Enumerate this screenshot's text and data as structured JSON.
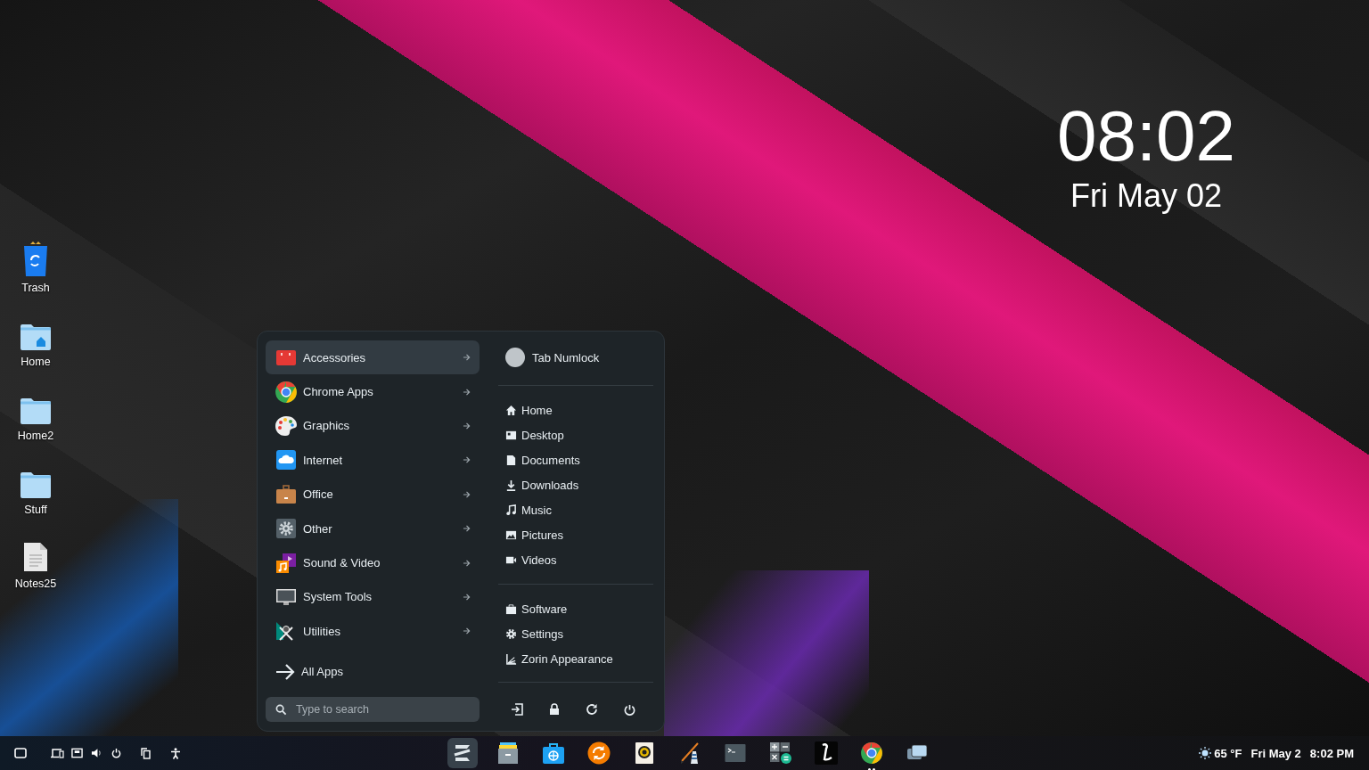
{
  "desktop_icons": [
    {
      "label": "Trash",
      "kind": "trash"
    },
    {
      "label": "Home",
      "kind": "home-folder"
    },
    {
      "label": "Home2",
      "kind": "folder"
    },
    {
      "label": "Stuff",
      "kind": "folder"
    },
    {
      "label": "Notes25",
      "kind": "text-file"
    }
  ],
  "clock": {
    "time": "08:02",
    "date": "Fri May 02"
  },
  "menu": {
    "categories": [
      {
        "label": "Accessories",
        "kind": "accessories",
        "selected": true
      },
      {
        "label": "Chrome Apps",
        "kind": "browser",
        "selected": false
      },
      {
        "label": "Graphics",
        "kind": "graphics",
        "selected": false
      },
      {
        "label": "Internet",
        "kind": "internet",
        "selected": false
      },
      {
        "label": "Office",
        "kind": "office",
        "selected": false
      },
      {
        "label": "Other",
        "kind": "other",
        "selected": false
      },
      {
        "label": "Sound & Video",
        "kind": "sound-video",
        "selected": false
      },
      {
        "label": "System Tools",
        "kind": "system-tools",
        "selected": false
      },
      {
        "label": "Utilities",
        "kind": "utilities",
        "selected": false
      }
    ],
    "all_apps": "All Apps",
    "search": {
      "placeholder": "Type to search"
    },
    "user": {
      "name": "Tab Numlock"
    },
    "places": [
      {
        "label": "Home",
        "kind": "home"
      },
      {
        "label": "Desktop",
        "kind": "desktop"
      },
      {
        "label": "Documents",
        "kind": "documents"
      },
      {
        "label": "Downloads",
        "kind": "downloads"
      },
      {
        "label": "Music",
        "kind": "music"
      },
      {
        "label": "Pictures",
        "kind": "pictures"
      },
      {
        "label": "Videos",
        "kind": "videos"
      }
    ],
    "system": [
      {
        "label": "Software",
        "kind": "software"
      },
      {
        "label": "Settings",
        "kind": "settings"
      },
      {
        "label": "Zorin Appearance",
        "kind": "appearance"
      }
    ]
  },
  "taskbar": {
    "apps": [
      {
        "kind": "zorin",
        "selected": true,
        "running": false
      },
      {
        "kind": "files",
        "selected": false,
        "running": false
      },
      {
        "kind": "store",
        "selected": false,
        "running": false
      },
      {
        "kind": "updater",
        "selected": false,
        "running": false
      },
      {
        "kind": "music-player",
        "selected": false,
        "running": false
      },
      {
        "kind": "paint",
        "selected": false,
        "running": false
      },
      {
        "kind": "terminal",
        "selected": false,
        "running": false
      },
      {
        "kind": "calculator",
        "selected": false,
        "running": false
      },
      {
        "kind": "text-editor",
        "selected": false,
        "running": false
      },
      {
        "kind": "browser",
        "selected": false,
        "running": true
      },
      {
        "kind": "windows",
        "selected": false,
        "running": false
      }
    ],
    "weather": "65 °F",
    "date": "Fri May 2",
    "time": "8:02 PM"
  }
}
